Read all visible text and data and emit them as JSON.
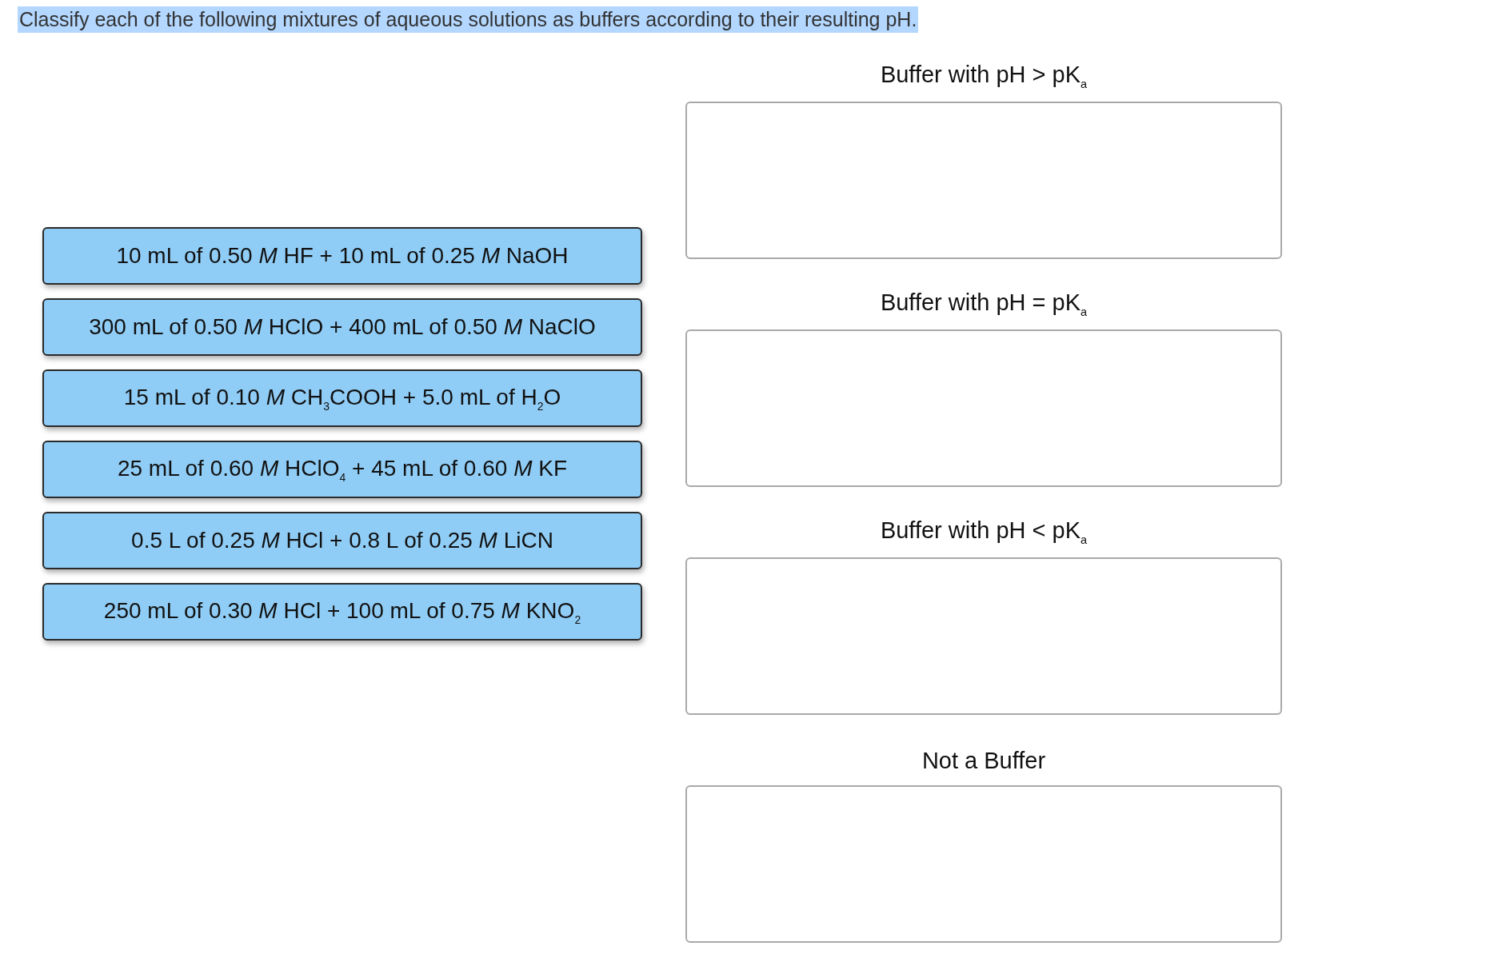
{
  "instruction": "Classify each of the following mixtures of aqueous solutions as buffers according to their resulting pH.",
  "items": [
    "10 mL of 0.50 *M* HF + 10 mL of 0.25 *M* NaOH",
    "300 mL of 0.50 *M* HClO + 400 mL of 0.50 *M* NaClO",
    "15 mL of 0.10 *M* CH$_{3}$COOH + 5.0 mL of H$_{2}$O",
    "25 mL of 0.60 *M* HClO$_{4}$ + 45 mL of 0.60 *M* KF",
    "0.5 L of 0.25 *M* HCl + 0.8 L of 0.25 *M* LiCN",
    "250 mL of 0.30 *M* HCl + 100 mL of 0.75 *M* KNO$_{2}$"
  ],
  "bins": [
    {
      "label": "Buffer with pH > pK$_{a}$"
    },
    {
      "label": "Buffer with pH = pK$_{a}$"
    },
    {
      "label": "Buffer with pH < pK$_{a}$"
    },
    {
      "label": "Not a Buffer"
    }
  ]
}
